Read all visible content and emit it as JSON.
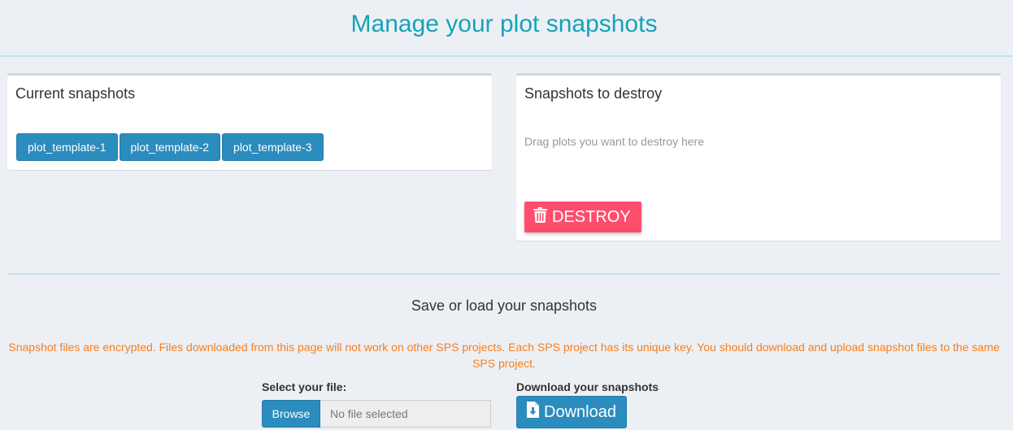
{
  "header": {
    "title": "Manage your plot snapshots"
  },
  "current": {
    "title": "Current snapshots",
    "snapshots": [
      "plot_template-1",
      "plot_template-2",
      "plot_template-3"
    ]
  },
  "destroy": {
    "title": "Snapshots to destroy",
    "hint": "Drag plots you want to destroy here",
    "button_label": "DESTROY",
    "button_icon": "trash-icon"
  },
  "save_load": {
    "title": "Save or load your snapshots",
    "warning": "Snapshot files are encrypted. Files downloaded from this page will not work on other SPS projects. Each SPS project has its unique key. You should download and upload snapshot files to the same SPS project.",
    "select_label": "Select your file:",
    "browse_label": "Browse",
    "file_value": "No file selected",
    "download_section_label": "Download your snapshots",
    "download_label": "Download",
    "download_icon": "file-download-icon"
  },
  "colors": {
    "title": "#17a2b8",
    "primary": "#2b8cbe",
    "danger": "#ff4d6d",
    "warning": "#f97d1a",
    "background": "#ecf0f5"
  }
}
